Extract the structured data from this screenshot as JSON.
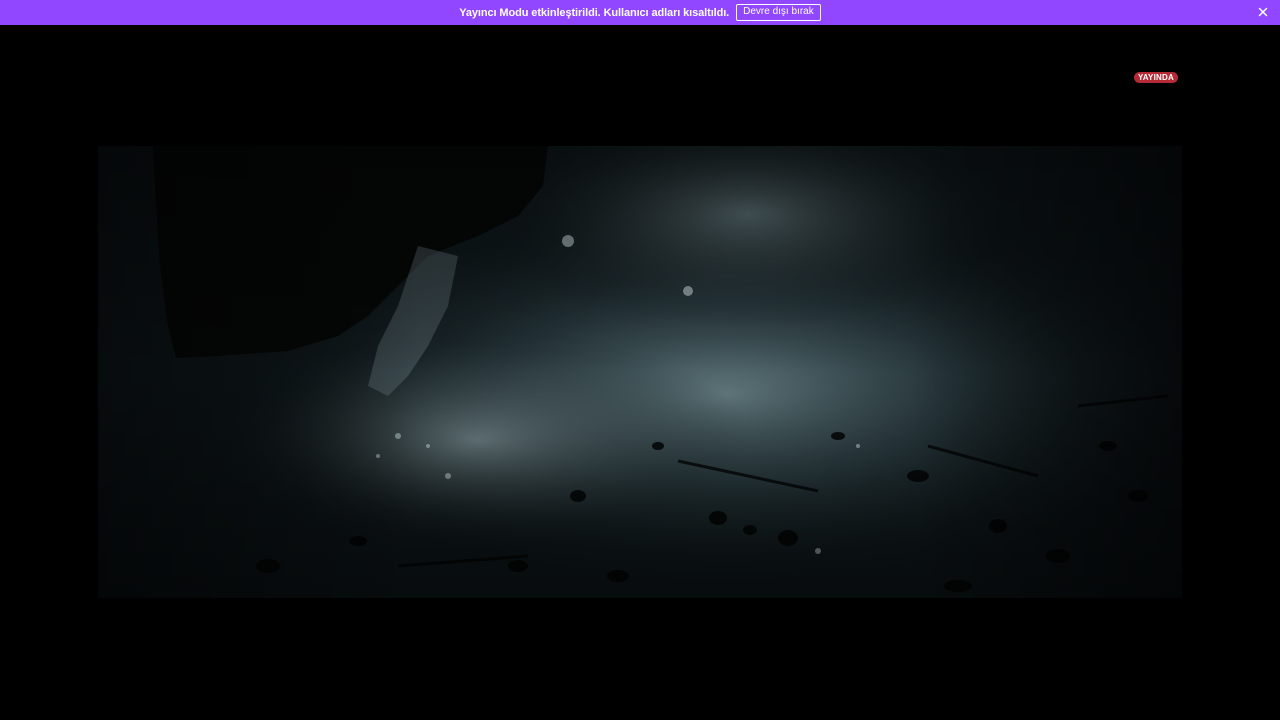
{
  "banner": {
    "message": "Yayıncı Modu etkinleştirildi. Kullanıcı adları kısaltıldı.",
    "disable_button": "Devre dışı bırak",
    "close_icon": "close-icon",
    "color": "#9147ff"
  },
  "player": {
    "live_badge": "YAYINDA",
    "live_color": "#b52a35",
    "video_description_icon": "video-frame"
  }
}
